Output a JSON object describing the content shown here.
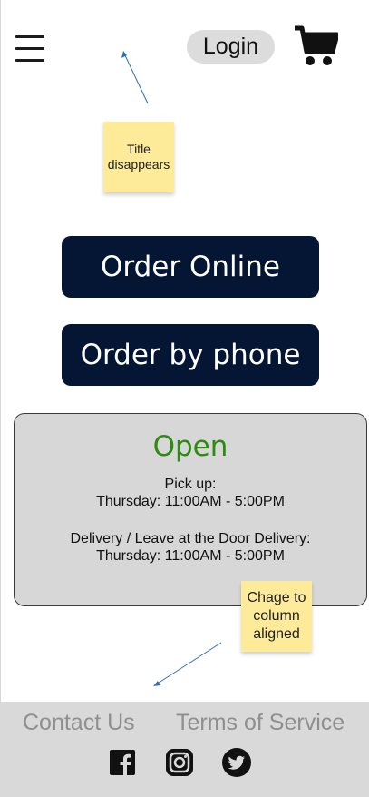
{
  "header": {
    "menu_icon": "hamburger-menu-icon",
    "login_label": "Login",
    "cart_icon": "shopping-cart-icon"
  },
  "annotations": {
    "title_note": "Title disappears",
    "column_note": "Chage to column aligned"
  },
  "main": {
    "order_online_label": "Order Online",
    "order_phone_label": "Order by phone"
  },
  "hours": {
    "status": "Open",
    "pickup_label": "Pick up:",
    "pickup_hours": "Thursday: 11:00AM - 5:00PM",
    "delivery_label": "Delivery / Leave at the Door Delivery:",
    "delivery_hours": "Thursday: 11:00AM - 5:00PM"
  },
  "footer": {
    "contact_label": "Contact Us",
    "terms_label": "Terms of Service",
    "social_icons": [
      "facebook-icon",
      "instagram-icon",
      "twitter-icon"
    ]
  },
  "colors": {
    "button_bg": "#041633",
    "status_green": "#2e8b12",
    "sticky_yellow": "#fdeb9a",
    "footer_bg": "#d9d9d9",
    "card_bg": "#d7d7d7"
  }
}
